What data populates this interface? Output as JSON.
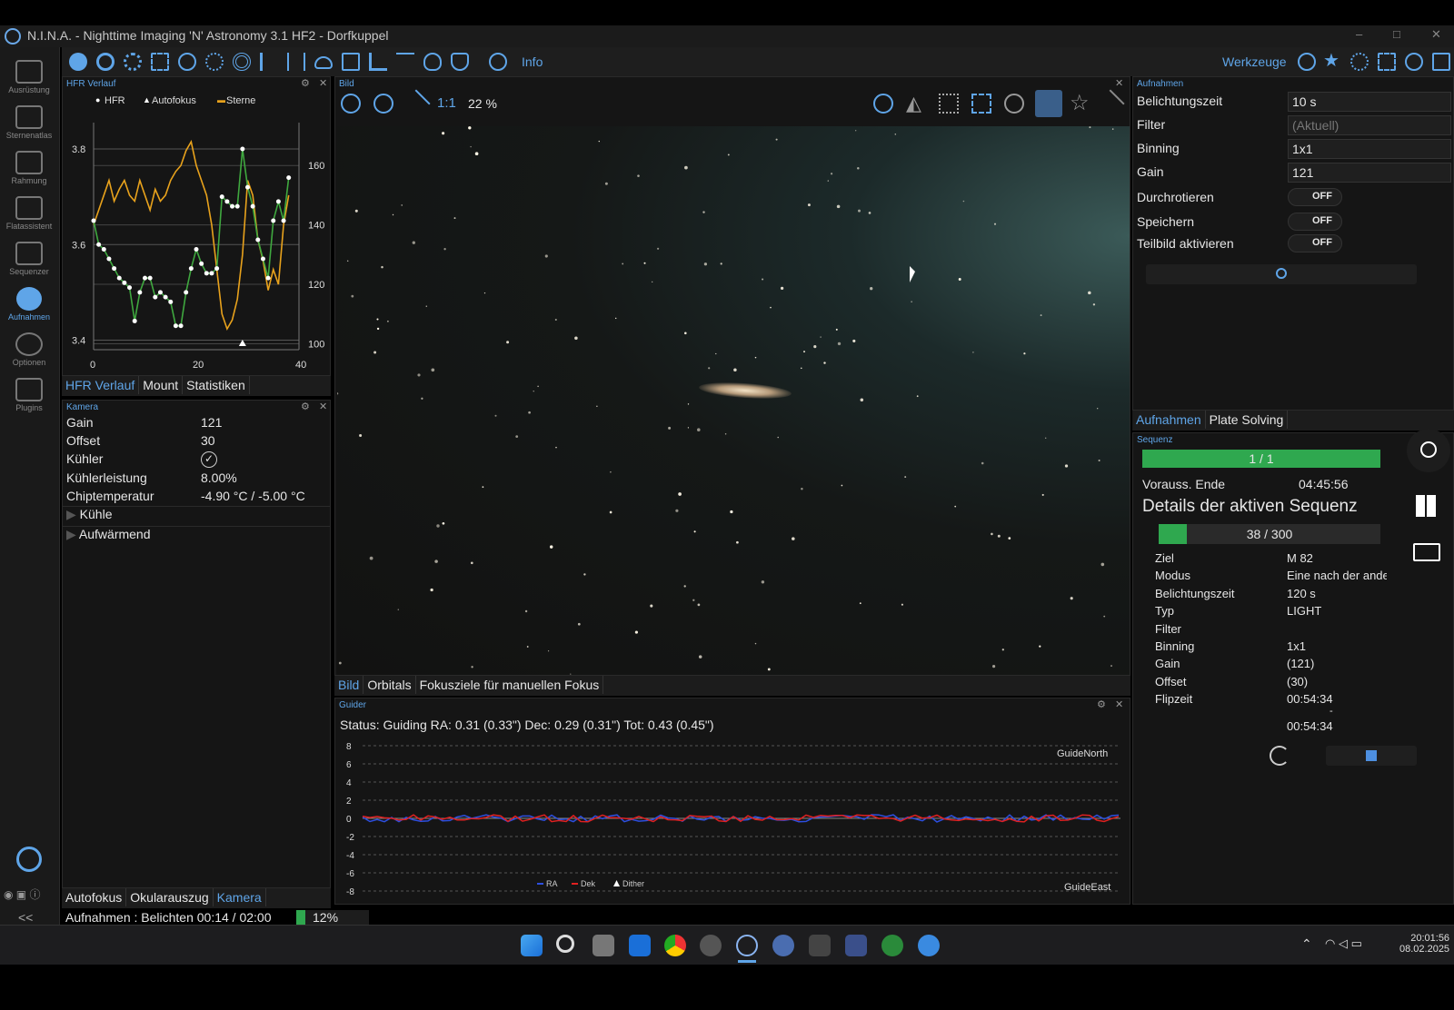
{
  "window": {
    "title": "N.I.N.A. - Nighttime Imaging 'N' Astronomy 3.1 HF2  -  Dorfkuppel",
    "min": "–",
    "max": "□",
    "close": "✕"
  },
  "toolbar": {
    "info": "Info",
    "werkzeuge": "Werkzeuge"
  },
  "sidebar": {
    "items": [
      "Ausrüstung",
      "Sternenatlas",
      "Rahmung",
      "Flatassistent",
      "Sequenzer",
      "Aufnahmen",
      "Optionen",
      "Plugins"
    ],
    "collapse": "<<"
  },
  "hfr": {
    "title": "HFR Verlauf",
    "legend": [
      "HFR",
      "Autofokus",
      "Sterne"
    ],
    "chart_data": {
      "type": "line",
      "x": [
        0,
        1,
        2,
        3,
        4,
        5,
        6,
        7,
        8,
        9,
        10,
        11,
        12,
        13,
        14,
        15,
        16,
        17,
        18,
        19,
        20,
        21,
        22,
        23,
        24,
        25,
        26,
        27,
        28,
        29,
        30,
        31,
        32,
        33,
        34,
        35,
        36,
        37,
        38
      ],
      "series": [
        {
          "name": "HFR",
          "values": [
            3.65,
            3.6,
            3.59,
            3.57,
            3.55,
            3.53,
            3.52,
            3.51,
            3.44,
            3.5,
            3.53,
            3.53,
            3.49,
            3.5,
            3.49,
            3.48,
            3.43,
            3.43,
            3.5,
            3.55,
            3.59,
            3.56,
            3.54,
            3.54,
            3.55,
            3.7,
            3.69,
            3.68,
            3.68,
            3.8,
            3.72,
            3.68,
            3.61,
            3.57,
            3.53,
            3.65,
            3.69,
            3.65,
            3.74
          ]
        },
        {
          "name": "Sterne",
          "values": [
            140,
            145,
            150,
            155,
            148,
            152,
            155,
            150,
            148,
            155,
            150,
            145,
            152,
            148,
            150,
            155,
            158,
            160,
            165,
            168,
            160,
            155,
            150,
            140,
            125,
            110,
            105,
            108,
            115,
            130,
            155,
            150,
            135,
            128,
            118,
            125,
            120,
            140,
            150
          ]
        }
      ],
      "autofokus_x": [
        29
      ],
      "xticks": [
        0,
        20,
        40
      ],
      "yticks_left": [
        3.4,
        3.6,
        3.8
      ],
      "yticks_right": [
        100,
        120,
        140,
        160
      ],
      "ylim": [
        3.38,
        3.84
      ],
      "ylim_right": [
        98,
        172
      ],
      "xlim": [
        0,
        40
      ]
    },
    "tabs": [
      "HFR Verlauf",
      "Mount",
      "Statistiken"
    ]
  },
  "kamera": {
    "title": "Kamera",
    "rows": [
      {
        "k": "Gain",
        "v": "121"
      },
      {
        "k": "Offset",
        "v": "30"
      },
      {
        "k": "Kühler",
        "v": "✓"
      },
      {
        "k": "Kühlerleistung",
        "v": "8.00%"
      },
      {
        "k": "Chiptemperatur",
        "v": "-4.90 °C / -5.00 °C"
      }
    ],
    "kuehle": "Kühle",
    "aufwaermend": "Aufwärmend",
    "tabs": [
      "Autofokus",
      "Okularauszug",
      "Kamera"
    ]
  },
  "bild": {
    "title": "Bild",
    "zoom_label": "1:1",
    "zoom_pct": "22 %",
    "tabs": [
      "Bild",
      "Orbitals",
      "Fokusziele für manuellen Fokus"
    ]
  },
  "guider": {
    "title": "Guider",
    "status": "Status: Guiding RA: 0.31 (0.33\") Dec: 0.29 (0.31\") Tot: 0.43 (0.45\")",
    "north": "GuideNorth",
    "east": "GuideEast",
    "yticks": [
      8,
      6,
      4,
      2,
      0,
      -2,
      -4,
      -6,
      -8
    ],
    "legend": [
      "RA",
      "Dek",
      "Dither"
    ]
  },
  "aufnahmen": {
    "title": "Aufnahmen",
    "rows": [
      {
        "k": "Belichtungszeit",
        "v": "10 s"
      },
      {
        "k": "Filter",
        "v": "(Aktuell)"
      },
      {
        "k": "Binning",
        "v": "1x1"
      },
      {
        "k": "Gain",
        "v": "121"
      }
    ],
    "toggles": [
      {
        "k": "Durchrotieren",
        "v": "OFF"
      },
      {
        "k": "Speichern",
        "v": "OFF"
      },
      {
        "k": "Teilbild aktivieren",
        "v": "OFF"
      }
    ],
    "tabs": [
      "Aufnahmen",
      "Plate Solving"
    ]
  },
  "sequenz": {
    "title": "Sequenz",
    "progress_label": "1 / 1",
    "progress": 1.0,
    "ende_k": "Vorauss. Ende",
    "ende_v": "04:45:56",
    "heading": "Details der aktiven Sequenz",
    "sub_progress_label": "38 / 300",
    "sub_progress": 0.127,
    "rows": [
      {
        "k": "Ziel",
        "v": "M 82"
      },
      {
        "k": "Modus",
        "v": "Eine nach der anderen"
      },
      {
        "k": "Belichtungszeit",
        "v": "120 s"
      },
      {
        "k": "Typ",
        "v": "LIGHT"
      },
      {
        "k": "Filter",
        "v": ""
      },
      {
        "k": "Binning",
        "v": "1x1"
      },
      {
        "k": "Gain",
        "v": "(121)"
      },
      {
        "k": "Offset",
        "v": "(30)"
      },
      {
        "k": "Flipzeit",
        "v": "00:54:34"
      }
    ],
    "flip2": "00:54:34",
    "dash": "-"
  },
  "status": {
    "text": "Aufnahmen :  Belichten 00:14 / 02:00",
    "pct": "12%",
    "progress": 0.12
  },
  "tray": {
    "time": "20:01:56",
    "date": "08.02.2025"
  }
}
